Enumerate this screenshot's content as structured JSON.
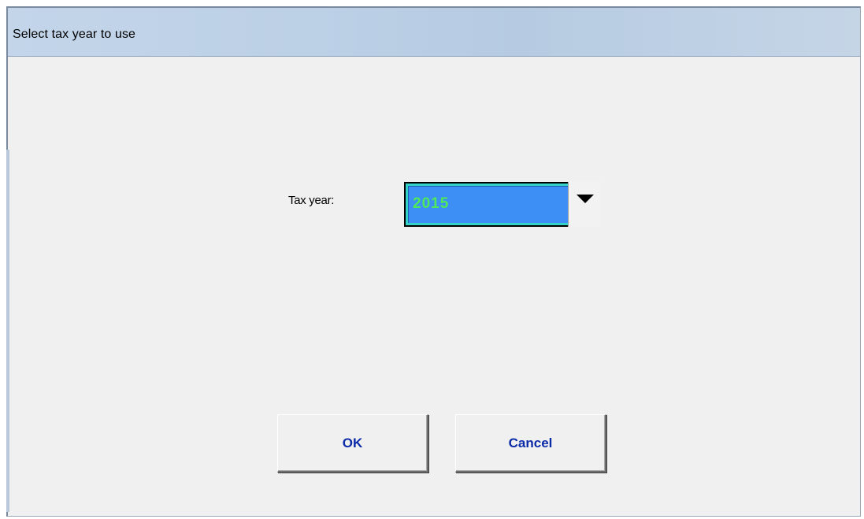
{
  "dialog": {
    "title": "Select tax year to use"
  },
  "form": {
    "tax_year_label": "Tax year:",
    "tax_year_value": "2015",
    "dropdown_icon": "chevron-down-icon"
  },
  "buttons": {
    "ok_label": "OK",
    "cancel_label": "Cancel"
  },
  "colors": {
    "titlebar": "#bcd0e6",
    "client_background": "#f0f0f0",
    "combo_highlight": "#3d8ff5",
    "combo_border": "#35d2c8",
    "selected_text": "#4fe85a",
    "button_text": "#0b2aa8"
  }
}
